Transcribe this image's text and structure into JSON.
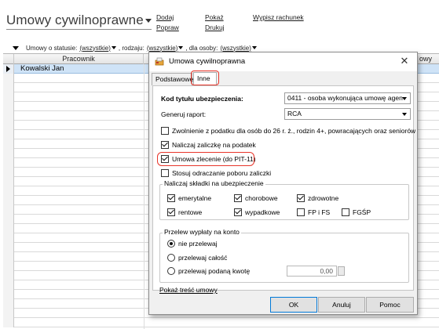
{
  "app": {
    "title": "Umowy cywilnoprawne",
    "links": {
      "dodaj": "Dodaj",
      "popraw": "Popraw",
      "pokaz": "Pokaż",
      "drukuj": "Drukuj",
      "wypisz": "Wypisz rachunek"
    },
    "filters": {
      "status_label": "Umowy o statusie:",
      "status_value": "(wszystkie)",
      "type_label": ", rodzaju:",
      "type_value": "(wszystkie)",
      "person_label": ", dla osoby:",
      "person_value": "(wszystkie)"
    },
    "grid": {
      "columns": [
        "Pracownik",
        "owy"
      ],
      "rows": [
        "Kowalski Jan"
      ]
    }
  },
  "dialog": {
    "title": "Umowa cywilnoprawna",
    "tabs": [
      "Podstawowe",
      "Inne"
    ],
    "active_tab": "Inne",
    "kod_label": "Kod tytułu ubezpieczenia:",
    "kod_value": "0411 - osoba wykonująca umowę agen",
    "raport_label": "Generuj raport:",
    "raport_value": "RCA",
    "checkboxes": {
      "zwolnienie": {
        "label": "Zwolnienie z podatku dla osób do 26 r. ż., rodzin 4+, powracających oraz seniorów",
        "checked": false
      },
      "zaliczka": {
        "label": "Naliczaj zaliczkę na podatek",
        "checked": true
      },
      "zlecenie": {
        "label": "Umowa zlecenie (do PIT-11)",
        "checked": true
      },
      "odraczanie": {
        "label": "Stosuj odraczanie poboru zaliczki",
        "checked": false
      }
    },
    "skladki": {
      "title": "Naliczaj składki na ubezpieczenie",
      "items": [
        {
          "label": "emerytalne",
          "checked": true
        },
        {
          "label": "chorobowe",
          "checked": true
        },
        {
          "label": "zdrowotne",
          "checked": true
        },
        {
          "label": "rentowe",
          "checked": true
        },
        {
          "label": "wypadkowe",
          "checked": true
        },
        {
          "label": "FP i FS",
          "checked": false
        },
        {
          "label": "FGŚP",
          "checked": false
        }
      ]
    },
    "przelew": {
      "title": "Przelew wypłaty na konto",
      "options": [
        "nie przelewaj",
        "przelewaj całość",
        "przelewaj podaną kwotę"
      ],
      "selected": "nie przelewaj",
      "amount": "0,00"
    },
    "tresc_link": "Pokaż treść umowy",
    "buttons": {
      "ok": "OK",
      "anuluj": "Anuluj",
      "pomoc": "Pomoc"
    },
    "highlight_color": "#e8352a"
  }
}
